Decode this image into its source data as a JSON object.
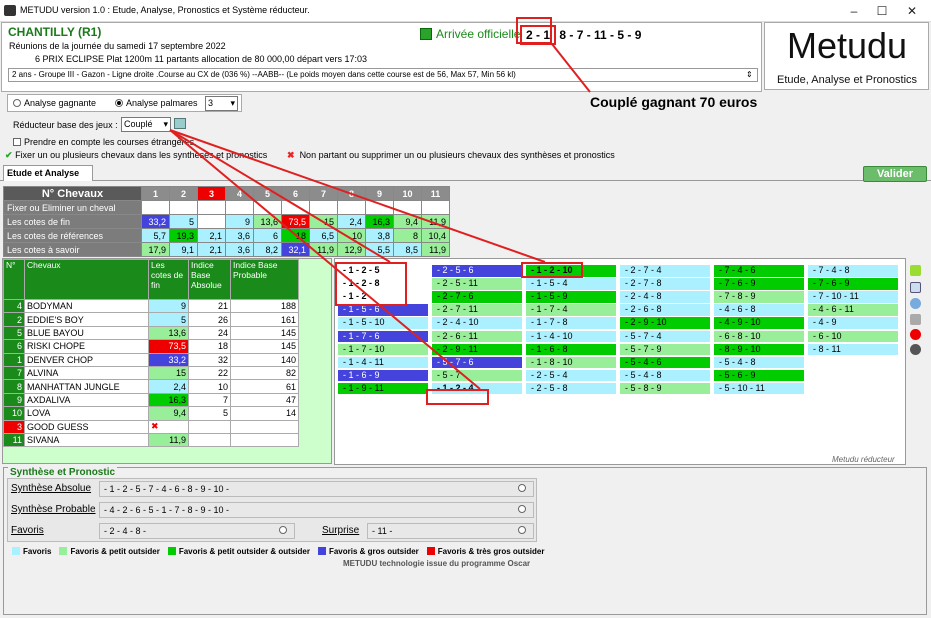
{
  "window": {
    "title": "METUDU version 1.0  : Etude, Analyse,  Pronostics et Système réducteur.",
    "minimize": "–",
    "maximize": "☐",
    "close": "✕"
  },
  "race": {
    "name": "CHANTILLY (R1)",
    "line1": "Réunions de la journée du samedi 17 septembre 2022",
    "line2": "6 PRIX ECLIPSE Plat 1200m 11 partants allocation de 80 000,00 départ vers 17:03",
    "conditions": "2 ans - Groupe III - Gazon - Ligne droite .Course au CX de (036 %)  --AABB--  (Le poids moyen dans cette course est de 56, Max 57, Min 56 kl)"
  },
  "arrivee": {
    "label": "Arrivée officielle",
    "first": "2 - 1",
    "rest": "8 - 7 - 11 - 5 - 9"
  },
  "logo": {
    "title": "Metudu",
    "subtitle": "Etude, Analyse et Pronostics"
  },
  "annotation": "Couplé gagnant 70 euros",
  "options": {
    "analyse_gagnante": "Analyse gagnante",
    "analyse_palmares": "Analyse palmares",
    "palmares_value": "3",
    "reducteur_label": "Réducteur base des jeux :",
    "reducteur_value": "Couplé",
    "etrangeres": "Prendre en compte les courses étrangères.",
    "fixer": "Fixer un ou plusieurs chevaux dans les synthèses et pronostics",
    "non_partant": "Non partant ou supprimer un ou plusieurs chevaux des synthèses et pronostics"
  },
  "tab": "Etude et Analyse",
  "valider": "Valider",
  "grid": {
    "header": "N° Chevaux",
    "numbers": [
      "1",
      "2",
      "3",
      "4",
      "5",
      "6",
      "7",
      "8",
      "9",
      "10",
      "11"
    ],
    "rows": [
      {
        "label": "Fixer ou Eliminer un cheval",
        "values": [
          "",
          "",
          "✖",
          "",
          "",
          "",
          "",
          "",
          "",
          "",
          ""
        ]
      },
      {
        "label": "Les cotes de fin",
        "values": [
          "33,2",
          "5",
          "",
          "9",
          "13,6",
          "73,5",
          "15",
          "2,4",
          "16,3",
          "9,4",
          "11,9"
        ]
      },
      {
        "label": "Les cotes de références",
        "values": [
          "5,7",
          "19,3",
          "2,1",
          "3,6",
          "6",
          "18",
          "6,5",
          "10",
          "3,8",
          "8",
          "10,4"
        ]
      },
      {
        "label": "Les cotes à savoir",
        "values": [
          "17,9",
          "9,1",
          "2,1",
          "3,6",
          "8,2",
          "32,1",
          "11,9",
          "12,9",
          "5,5",
          "8,5",
          "11,9"
        ]
      }
    ]
  },
  "horses": {
    "headers": [
      "N°",
      "Chevaux",
      "Les cotes de fin",
      "Indice Base Absolue",
      "Indice Base Probable"
    ],
    "rows": [
      {
        "n": "4",
        "name": "BODYMAN",
        "cote": "9",
        "abs": "21",
        "prob": "188"
      },
      {
        "n": "2",
        "name": "EDDIE'S BOY",
        "cote": "5",
        "abs": "26",
        "prob": "161"
      },
      {
        "n": "5",
        "name": "BLUE BAYOU",
        "cote": "13,6",
        "abs": "24",
        "prob": "145"
      },
      {
        "n": "6",
        "name": "RISKI CHOPE",
        "cote": "73,5",
        "abs": "18",
        "prob": "145"
      },
      {
        "n": "1",
        "name": "DENVER CHOP",
        "cote": "33,2",
        "abs": "32",
        "prob": "140"
      },
      {
        "n": "7",
        "name": "ALVINA",
        "cote": "15",
        "abs": "22",
        "prob": "82"
      },
      {
        "n": "8",
        "name": "MANHATTAN JUNGLE",
        "cote": "2,4",
        "abs": "10",
        "prob": "61"
      },
      {
        "n": "9",
        "name": "AXDALIVA",
        "cote": "16,3",
        "abs": "7",
        "prob": "47"
      },
      {
        "n": "10",
        "name": "LOVA",
        "cote": "9,4",
        "abs": "5",
        "prob": "14"
      },
      {
        "n": "3",
        "name": "GOOD GUESS",
        "cote": "",
        "abs": "",
        "prob": ""
      },
      {
        "n": "11",
        "name": "SIVANA",
        "cote": "11,9",
        "abs": "",
        "prob": ""
      }
    ]
  },
  "combos": [
    [
      "- 1 - 2 - 5",
      "- 1 - 2 - 8",
      "- 1 - 2",
      "- 1 - 5 - 6",
      "- 1 - 5 - 10",
      "- 1 - 7 - 6",
      "- 1 - 7 - 10",
      "- 1 - 4 - 11",
      "- 1 - 6 - 9",
      "- 1 - 9 - 11"
    ],
    [
      "- 2 - 5 - 6",
      "- 2 - 5 - 11",
      "- 2 - 7 - 6",
      "- 2 - 7 - 11",
      "- 2 - 4 - 10",
      "- 2 - 6 - 11",
      "- 2 - 9 - 11",
      "- 5 - 7 - 6",
      "- 5 - 7",
      "- 1 - 2 - 4"
    ],
    [
      "- 1 - 2 - 10",
      "- 1 - 5 - 4",
      "- 1 - 5 - 9",
      "- 1 - 7 - 4",
      "- 1 - 7 - 8",
      "- 1 - 4 - 10",
      "- 1 - 6 - 8",
      "- 1 - 8 - 10",
      "- 2 - 5 - 4",
      "- 2 - 5 - 8"
    ],
    [
      "- 2 - 7 - 4",
      "- 2 - 7 - 8",
      "- 2 - 4 - 8",
      "- 2 - 6 - 8",
      "- 2 - 9 - 10",
      "- 5 - 7 - 4",
      "- 5 - 7 - 9",
      "- 5 - 4 - 6",
      "- 5 - 4 - 8",
      "- 5 - 8 - 9"
    ],
    [
      "- 7 - 4 - 6",
      "- 7 - 6 - 9",
      "- 7 - 8 - 9",
      "- 4 - 6 - 8",
      "- 4 - 9 - 10",
      "- 6 - 8 - 10",
      "- 8 - 9 - 10",
      "- 5 - 4 - 8",
      "- 5 - 6 - 9",
      "- 5 - 10 - 11"
    ],
    [
      "- 7 - 4 - 8",
      "- 7 - 6 - 9",
      "- 7 - 10 - 11",
      "- 4 - 6 - 11",
      "- 4 - 9",
      "- 6 - 10",
      "- 8 - 11"
    ]
  ],
  "reducteur_footer": "Metudu réducteur",
  "synthese": {
    "title": "Synthèse et Pronostic",
    "absolue_label": "Synthèse Absolue",
    "absolue": "- 1 - 2 - 5 - 7 - 4 - 6 - 8 - 9 - 10 -",
    "probable_label": "Synthèse Probable",
    "probable": "- 4 - 2 - 6 - 5 - 1 - 7 - 8 - 9 - 10 -",
    "favoris_label": "Favoris",
    "favoris": "- 2 - 4 - 8 -",
    "surprise_label": "Surprise",
    "surprise": "- 11 -"
  },
  "legend": [
    "Favoris",
    "Favoris & petit outsider",
    "Favoris & petit outsider & outsider",
    "Favoris & gros outsider",
    "Favoris & très gros outsider"
  ],
  "legend_colors": [
    "#aaf0ff",
    "#99ee99",
    "#00cc00",
    "#4444dd",
    "#ee0000"
  ],
  "credit": "METUDU technologie issue du programme Oscar"
}
